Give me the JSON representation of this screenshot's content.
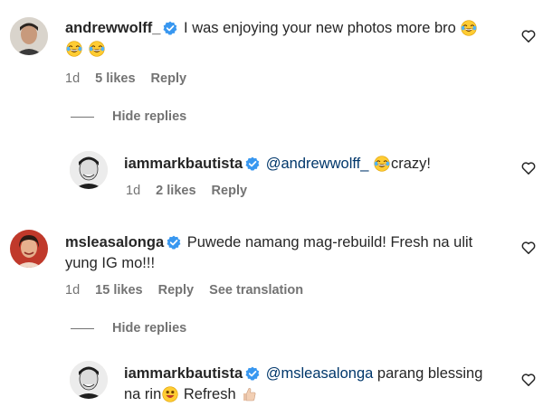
{
  "comments": [
    {
      "username": "andrewwolff_",
      "text": "I was enjoying your new photos more bro",
      "time": "1d",
      "likes": "5 likes",
      "reply": "Reply"
    },
    {
      "username": "iammarkbautista",
      "mention": "@andrewwolff_",
      "text": "crazy!",
      "time": "1d",
      "likes": "2 likes",
      "reply": "Reply"
    },
    {
      "username": "msleasalonga",
      "text_line1": "Puwede namang mag-rebuild! Fresh na ulit",
      "text_line2": "yung IG mo!!!",
      "time": "1d",
      "likes": "15 likes",
      "reply": "Reply",
      "translate": "See translation"
    },
    {
      "username": "iammarkbautista",
      "mention": "@msleasalonga",
      "text_line1": "parang blessing",
      "text_line2_a": "na rin",
      "text_line2_b": "Refresh"
    }
  ],
  "hide_replies_1": "Hide replies",
  "hide_replies_2": "Hide replies",
  "icons": {
    "verified": "verified-badge-icon",
    "heart": "heart-outline-icon",
    "emoji_laugh": "tears-of-joy-emoji",
    "emoji_grin": "grinning-emoji",
    "emoji_thumb": "thumbs-up-emoji"
  },
  "colors": {
    "verified": "#3897f0",
    "text": "#262626",
    "muted": "#737373",
    "mention": "#00376b"
  }
}
